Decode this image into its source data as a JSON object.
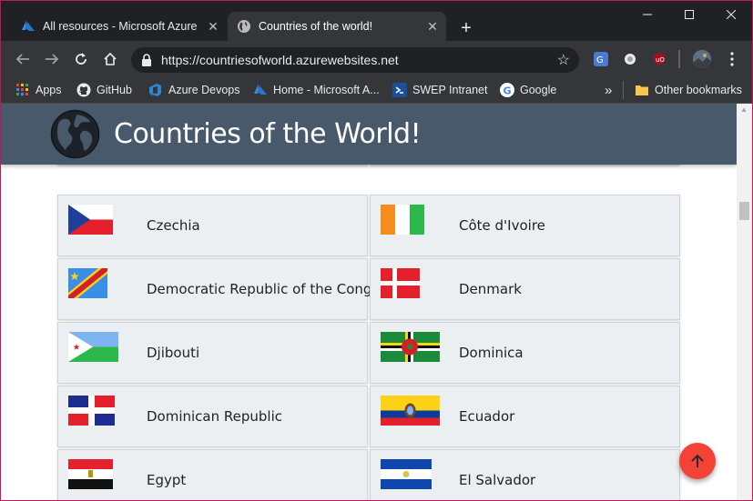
{
  "browser": {
    "tabs": [
      {
        "title": "All resources - Microsoft Azure",
        "icon": "azure-icon"
      },
      {
        "title": "Countries of the world!",
        "icon": "globe-icon",
        "active": true
      }
    ],
    "address": "https://countriesofworld.azurewebsites.net",
    "bookmarks": [
      {
        "label": "Apps",
        "icon": "apps-grid-icon"
      },
      {
        "label": "GitHub",
        "icon": "github-icon"
      },
      {
        "label": "Azure Devops",
        "icon": "azure-devops-icon"
      },
      {
        "label": "Home - Microsoft A...",
        "icon": "azure-icon"
      },
      {
        "label": "SWEP Intranet",
        "icon": "swep-icon"
      },
      {
        "label": "Google",
        "icon": "google-icon"
      }
    ],
    "overflow_label": "»",
    "other_bookmarks": "Other bookmarks"
  },
  "site": {
    "title": "Countries of the World!"
  },
  "countries": [
    {
      "name": "Czechia",
      "flag": "czechia-flag"
    },
    {
      "name": "Côte d'Ivoire",
      "flag": "cote-divoire-flag"
    },
    {
      "name": "Democratic Republic of the Congo",
      "flag": "drc-flag"
    },
    {
      "name": "Denmark",
      "flag": "denmark-flag"
    },
    {
      "name": "Djibouti",
      "flag": "djibouti-flag"
    },
    {
      "name": "Dominica",
      "flag": "dominica-flag"
    },
    {
      "name": "Dominican Republic",
      "flag": "dominican-republic-flag"
    },
    {
      "name": "Ecuador",
      "flag": "ecuador-flag"
    },
    {
      "name": "Egypt",
      "flag": "egypt-flag"
    },
    {
      "name": "El Salvador",
      "flag": "el-salvador-flag"
    }
  ],
  "colors": {
    "header_bg": "#47596b",
    "card_bg": "#eceff1",
    "fab": "#f44336"
  }
}
